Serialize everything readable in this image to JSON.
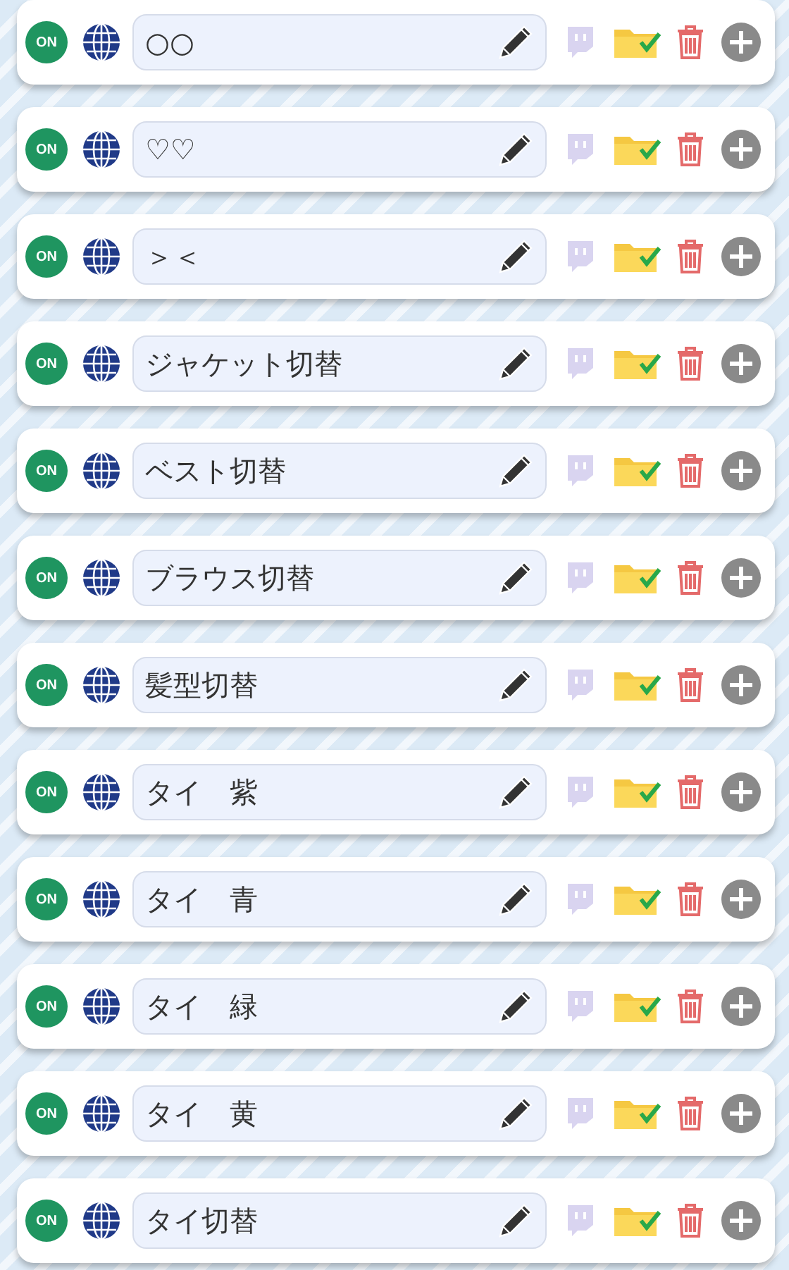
{
  "rows": [
    {
      "on": true,
      "status": "ON",
      "name": "○○"
    },
    {
      "on": true,
      "status": "ON",
      "name": "♡♡"
    },
    {
      "on": true,
      "status": "ON",
      "name": "＞＜"
    },
    {
      "on": true,
      "status": "ON",
      "name": "ジャケット切替"
    },
    {
      "on": true,
      "status": "ON",
      "name": "ベスト切替"
    },
    {
      "on": true,
      "status": "ON",
      "name": "ブラウス切替"
    },
    {
      "on": true,
      "status": "ON",
      "name": "髪型切替"
    },
    {
      "on": true,
      "status": "ON",
      "name": "タイ　紫"
    },
    {
      "on": true,
      "status": "ON",
      "name": "タイ　青"
    },
    {
      "on": true,
      "status": "ON",
      "name": "タイ　緑"
    },
    {
      "on": true,
      "status": "ON",
      "name": "タイ　黄"
    },
    {
      "on": true,
      "status": "ON",
      "name": "タイ切替"
    }
  ]
}
